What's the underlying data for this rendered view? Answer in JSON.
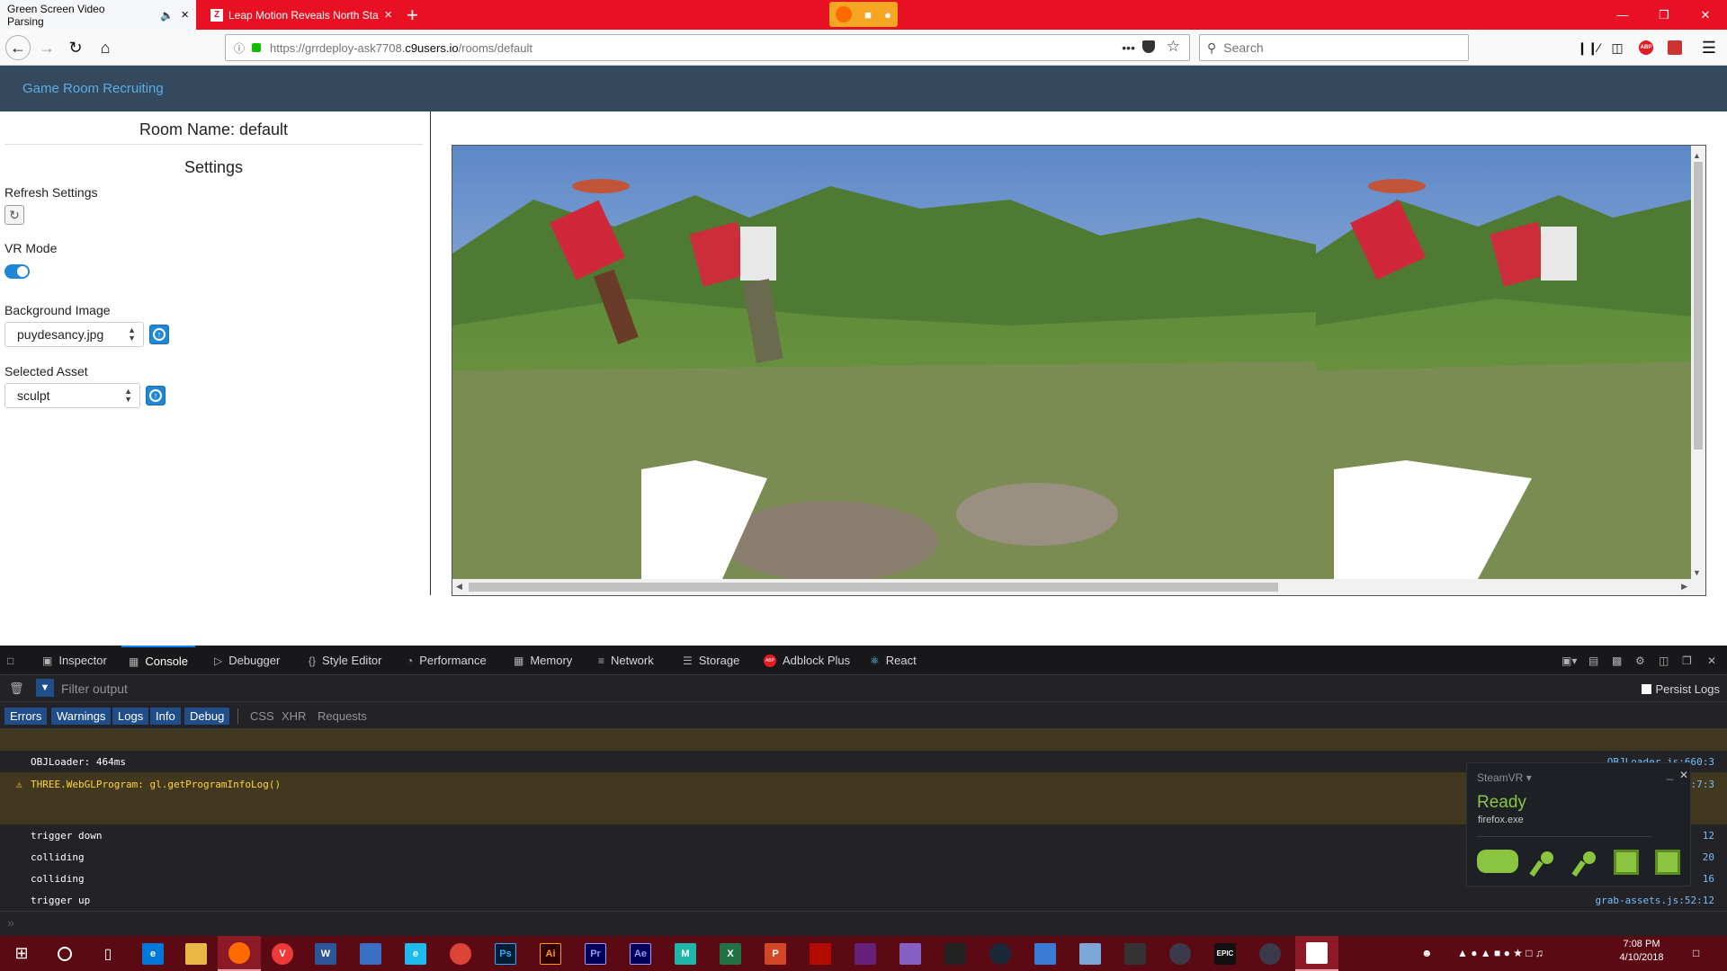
{
  "browser": {
    "tabs": [
      {
        "title": "Green Screen Video Parsing",
        "active": true
      },
      {
        "title": "Leap Motion Reveals North Sta",
        "active": false
      }
    ],
    "url": {
      "prefix": "https://grrdeploy-ask7708.",
      "domain": "c9users.io",
      "path": "/rooms/default"
    },
    "search_placeholder": "Search",
    "window_controls": [
      "minimize-icon",
      "restore-icon",
      "close-icon"
    ]
  },
  "site": {
    "brand": "Game Room Recruiting"
  },
  "sidebar": {
    "room_label": "Room Name: default",
    "settings_title": "Settings",
    "refresh_label": "Refresh Settings",
    "vr_mode_label": "VR Mode",
    "vr_mode_on": true,
    "background_label": "Background Image",
    "background_value": "puydesancy.jpg",
    "asset_label": "Selected Asset",
    "asset_value": "sculpt"
  },
  "devtools": {
    "tabs": [
      "Inspector",
      "Console",
      "Debugger",
      "Style Editor",
      "Performance",
      "Memory",
      "Network",
      "Storage",
      "Adblock Plus",
      "React"
    ],
    "selected_tab": "Console",
    "filter_placeholder": "Filter output",
    "persist_logs": "Persist Logs",
    "level_filters": [
      "Errors",
      "Warnings",
      "Logs",
      "Info",
      "Debug"
    ],
    "type_filters": [
      "CSS",
      "XHR",
      "Requests"
    ],
    "messages": [
      {
        "text": "OBJLoader: 464ms",
        "type": "log",
        "location": "OBJLoader.js:660:3"
      },
      {
        "text": "THREE.WebGLProgram: gl.getProgramInfoLog()",
        "type": "warning",
        "location": ":7:3"
      },
      {
        "text": "trigger down",
        "type": "log",
        "location": "12"
      },
      {
        "text": "colliding",
        "type": "log",
        "location": "20"
      },
      {
        "text": "colliding",
        "type": "log",
        "location": "16"
      },
      {
        "text": "trigger up",
        "type": "log",
        "location": "grab-assets.js:52:12"
      }
    ]
  },
  "steamvr": {
    "title": "SteamVR",
    "status": "Ready",
    "process": "firefox.exe",
    "status_color": "#8bc53f"
  },
  "taskbar": {
    "clock_time": "7:08 PM",
    "clock_date": "4/10/2018"
  }
}
